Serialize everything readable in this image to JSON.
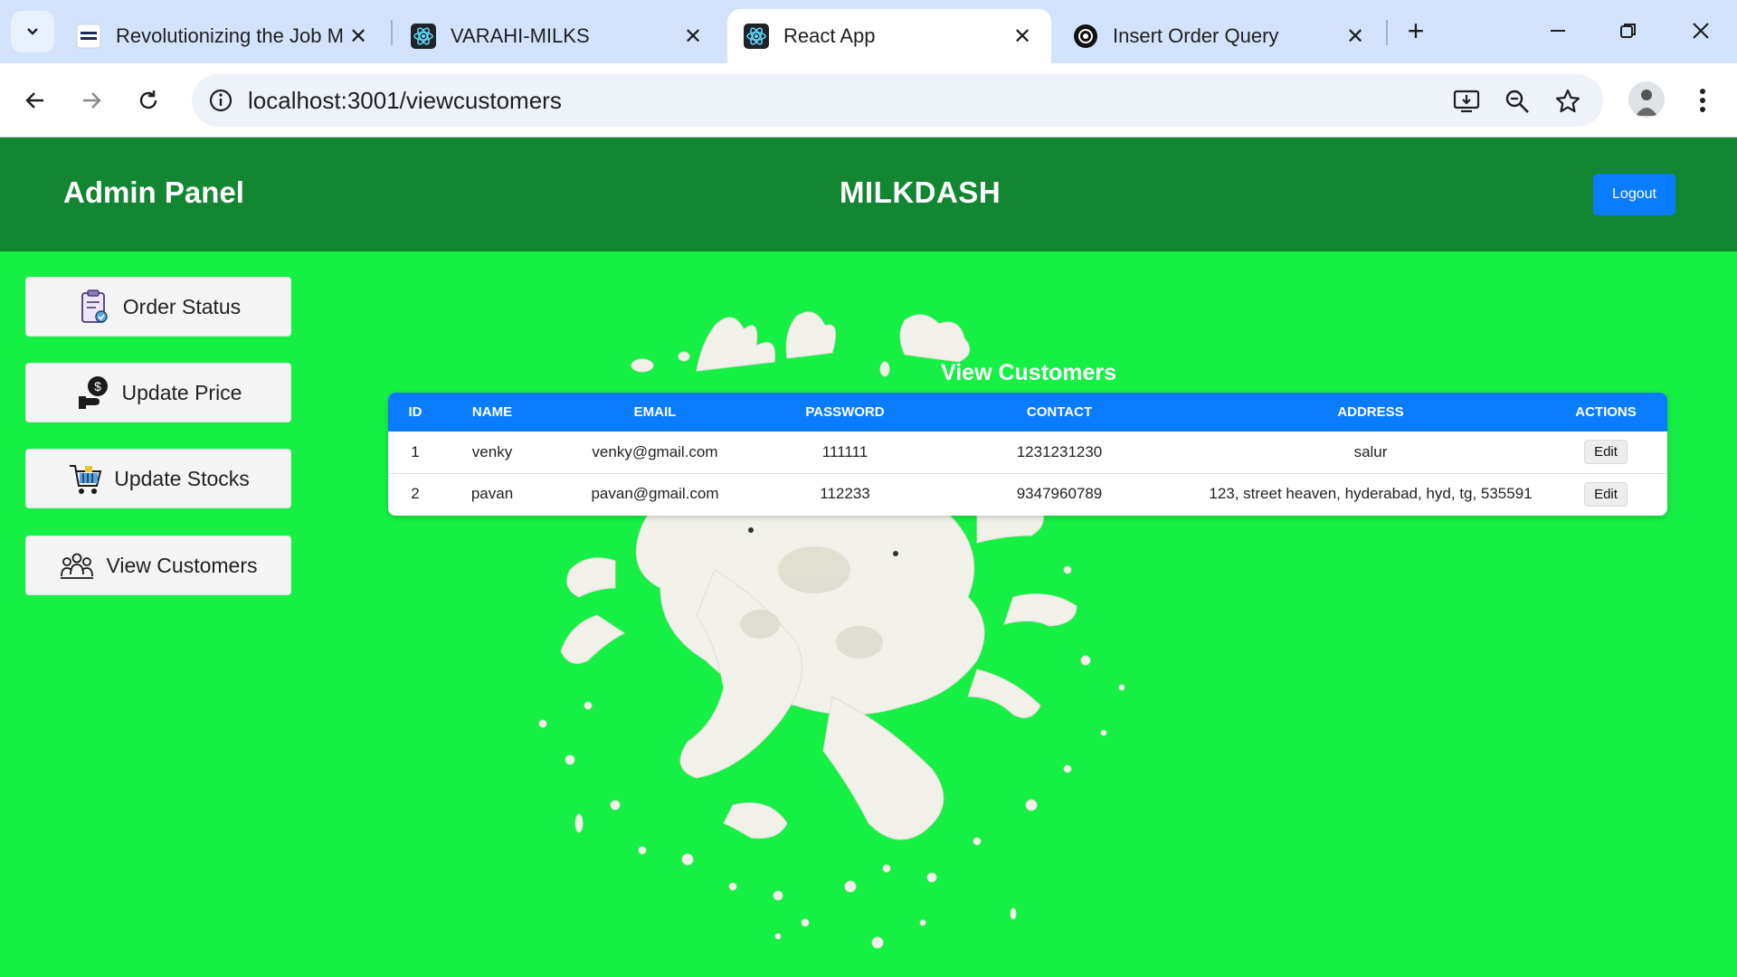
{
  "browser": {
    "tabs": [
      {
        "title": "Revolutionizing the Job M",
        "favicon": "nxtwave-icon",
        "active": false
      },
      {
        "title": "VARAHI-MILKS",
        "favicon": "react-icon",
        "active": false
      },
      {
        "title": "React App",
        "favicon": "react-icon",
        "active": true
      },
      {
        "title": "Insert Order Query",
        "favicon": "openai-icon",
        "active": false
      }
    ],
    "url": "localhost:3001/viewcustomers"
  },
  "header": {
    "left_title": "Admin Panel",
    "center_title": "MILKDASH",
    "logout_label": "Logout"
  },
  "sidebar": {
    "items": [
      {
        "label": "Order Status",
        "icon": "clipboard-icon"
      },
      {
        "label": "Update Price",
        "icon": "money-hand-icon"
      },
      {
        "label": "Update Stocks",
        "icon": "cart-icon"
      },
      {
        "label": "View Customers",
        "icon": "people-icon"
      }
    ]
  },
  "main": {
    "title": "View Customers",
    "columns": [
      "ID",
      "NAME",
      "EMAIL",
      "PASSWORD",
      "CONTACT",
      "ADDRESS",
      "ACTIONS"
    ],
    "rows": [
      {
        "id": "1",
        "name": "venky",
        "email": "venky@gmail.com",
        "password": "111111",
        "contact": "1231231230",
        "address": "salur",
        "action": "Edit"
      },
      {
        "id": "2",
        "name": "pavan",
        "email": "pavan@gmail.com",
        "password": "112233",
        "contact": "9347960789",
        "address": "123, street heaven, hyderabad, hyd, tg, 535591",
        "action": "Edit"
      }
    ]
  },
  "colors": {
    "page_bg": "#16ef44",
    "header_bg": "#138632",
    "accent_blue": "#0a7cff"
  }
}
